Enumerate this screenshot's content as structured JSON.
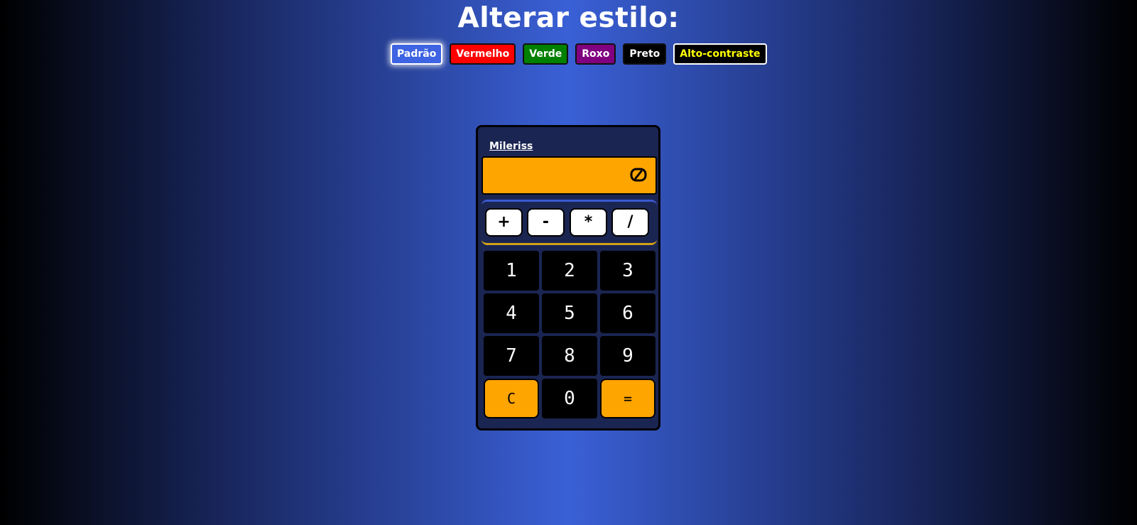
{
  "header": {
    "title": "Alterar estilo:"
  },
  "styles": {
    "buttons": [
      "Padrão",
      "Vermelho",
      "Verde",
      "Roxo",
      "Preto",
      "Alto-contraste"
    ],
    "selected": "Padrão"
  },
  "calculator": {
    "brand": "Mileriss",
    "display_value": "",
    "display_icon": "zero-icon",
    "operators": [
      "+",
      "-",
      "*",
      "/"
    ],
    "keys": [
      "1",
      "2",
      "3",
      "4",
      "5",
      "6",
      "7",
      "8",
      "9",
      "C",
      "0",
      "="
    ]
  },
  "colors": {
    "display": "#ffa500",
    "accent_blue": "#3e63e3",
    "vermelho": "#ff0000",
    "verde": "#008000",
    "roxo": "#800080",
    "preto": "#000000",
    "alto_contraste_text": "#ffff00",
    "calculator_body": "#1b2552"
  }
}
